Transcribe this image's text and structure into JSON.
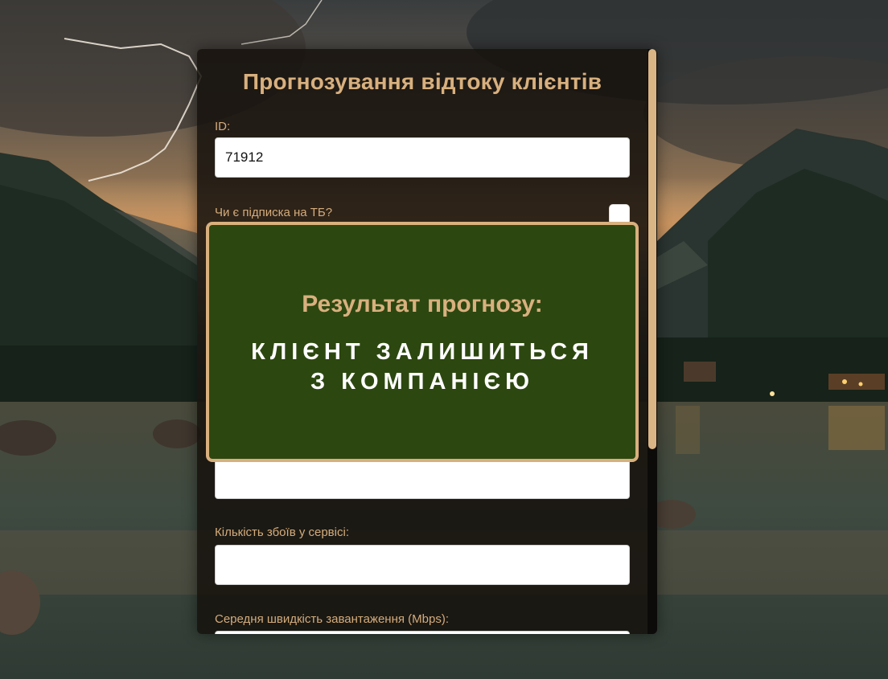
{
  "form": {
    "title": "Прогнозування відтоку клієнтів",
    "fields": {
      "id": {
        "label": "ID:",
        "value": "71912"
      },
      "tv_subscription": {
        "label": "Чи є підписка на ТБ?",
        "checked": false
      },
      "hidden_field": {
        "value": ""
      },
      "service_failures": {
        "label": "Кількість збоїв у сервісі:",
        "value": ""
      },
      "download_speed": {
        "label": "Середня швидкість завантаження (Mbps):",
        "value": ""
      }
    }
  },
  "result": {
    "title": "Результат прогнозу:",
    "line1": "КЛІЄНТ ЗАЛИШИТЬСЯ",
    "line2": "З КОМПАНІЄЮ"
  },
  "colors": {
    "accent": "#d8b07e",
    "result_bg": "#2d4710",
    "card_bg": "#16110d"
  }
}
